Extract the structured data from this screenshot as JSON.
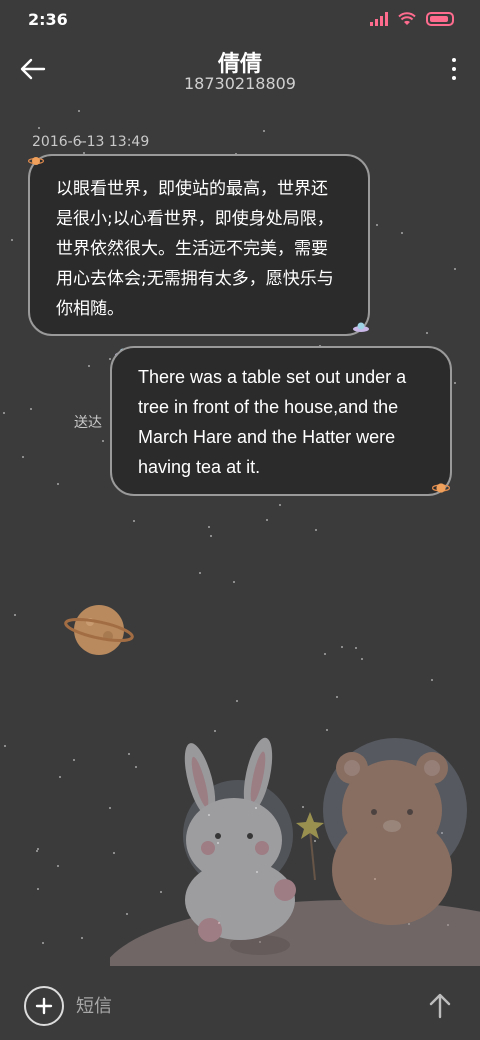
{
  "status_bar": {
    "time": "2:36",
    "icons": [
      "signal-icon",
      "wifi-icon",
      "battery-icon"
    ],
    "battery_color": "#ff6c8e"
  },
  "header": {
    "contact_name": "倩倩",
    "contact_number": "18730218809",
    "icons": [
      "back-arrow-icon",
      "more-vert-icon"
    ]
  },
  "conversation": {
    "timestamp": "2016-6-13 13:49",
    "received_message": "以眼看世界，即使站的最高，世界还是很小;以心看世界，即使身处局限，世界依然很大。生活远不完美，需要用心去体会;无需拥有太多，愿快乐与你相随。",
    "sent_message": "There was a table set out under a tree in front of the house,and the March Hare and the Hatter were having tea at it.",
    "sent_status": "送达"
  },
  "input_bar": {
    "placeholder": "短信",
    "icons": [
      "add-icon",
      "send-arrow-icon"
    ]
  },
  "theme": {
    "background": "#3b3b3c",
    "bubble_background": "#2b2b2c",
    "bubble_border": "#9a9a9a"
  }
}
